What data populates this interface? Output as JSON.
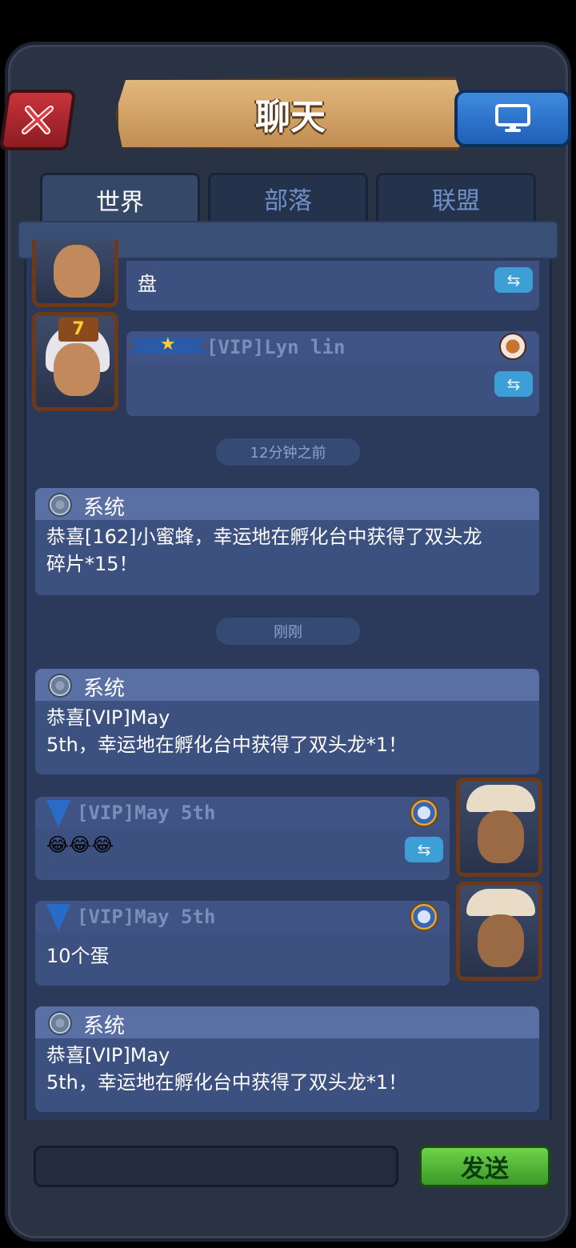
{
  "header": {
    "title": "聊天"
  },
  "tabs": [
    {
      "label": "世界",
      "active": true
    },
    {
      "label": "部落",
      "active": false
    },
    {
      "label": "联盟",
      "active": false
    }
  ],
  "messages": {
    "partial_top": {
      "text": "盘"
    },
    "lyn": {
      "name": "[VIP]Lyn lin",
      "level": "7"
    },
    "time1": "12分钟之前",
    "sys1": {
      "title": "系统",
      "line1": "恭喜[162]小蜜蜂，幸运地在孵化台中获得了双头龙",
      "line2": "碎片*15！"
    },
    "time2": "刚刚",
    "sys2": {
      "title": "系统",
      "line1": "恭喜[VIP]May",
      "line2": "5th，幸运地在孵化台中获得了双头龙*1！"
    },
    "may1": {
      "name": "[VIP]May 5th",
      "text": "😂😂😂"
    },
    "may2": {
      "name": "[VIP]May 5th",
      "text": "10个蛋"
    },
    "sys3": {
      "title": "系统",
      "line1": "恭喜[VIP]May",
      "line2": "5th，幸运地在孵化台中获得了双头龙*1！"
    }
  },
  "footer": {
    "send_label": "发送",
    "input_value": ""
  },
  "icons": {
    "close": "close-icon",
    "screen": "monitor-icon",
    "reply": "reply-icon",
    "gear": "gear-icon"
  },
  "colors": {
    "accent_green": "#4db32e",
    "close_red": "#c8333a",
    "screen_blue": "#2f7ad6"
  }
}
